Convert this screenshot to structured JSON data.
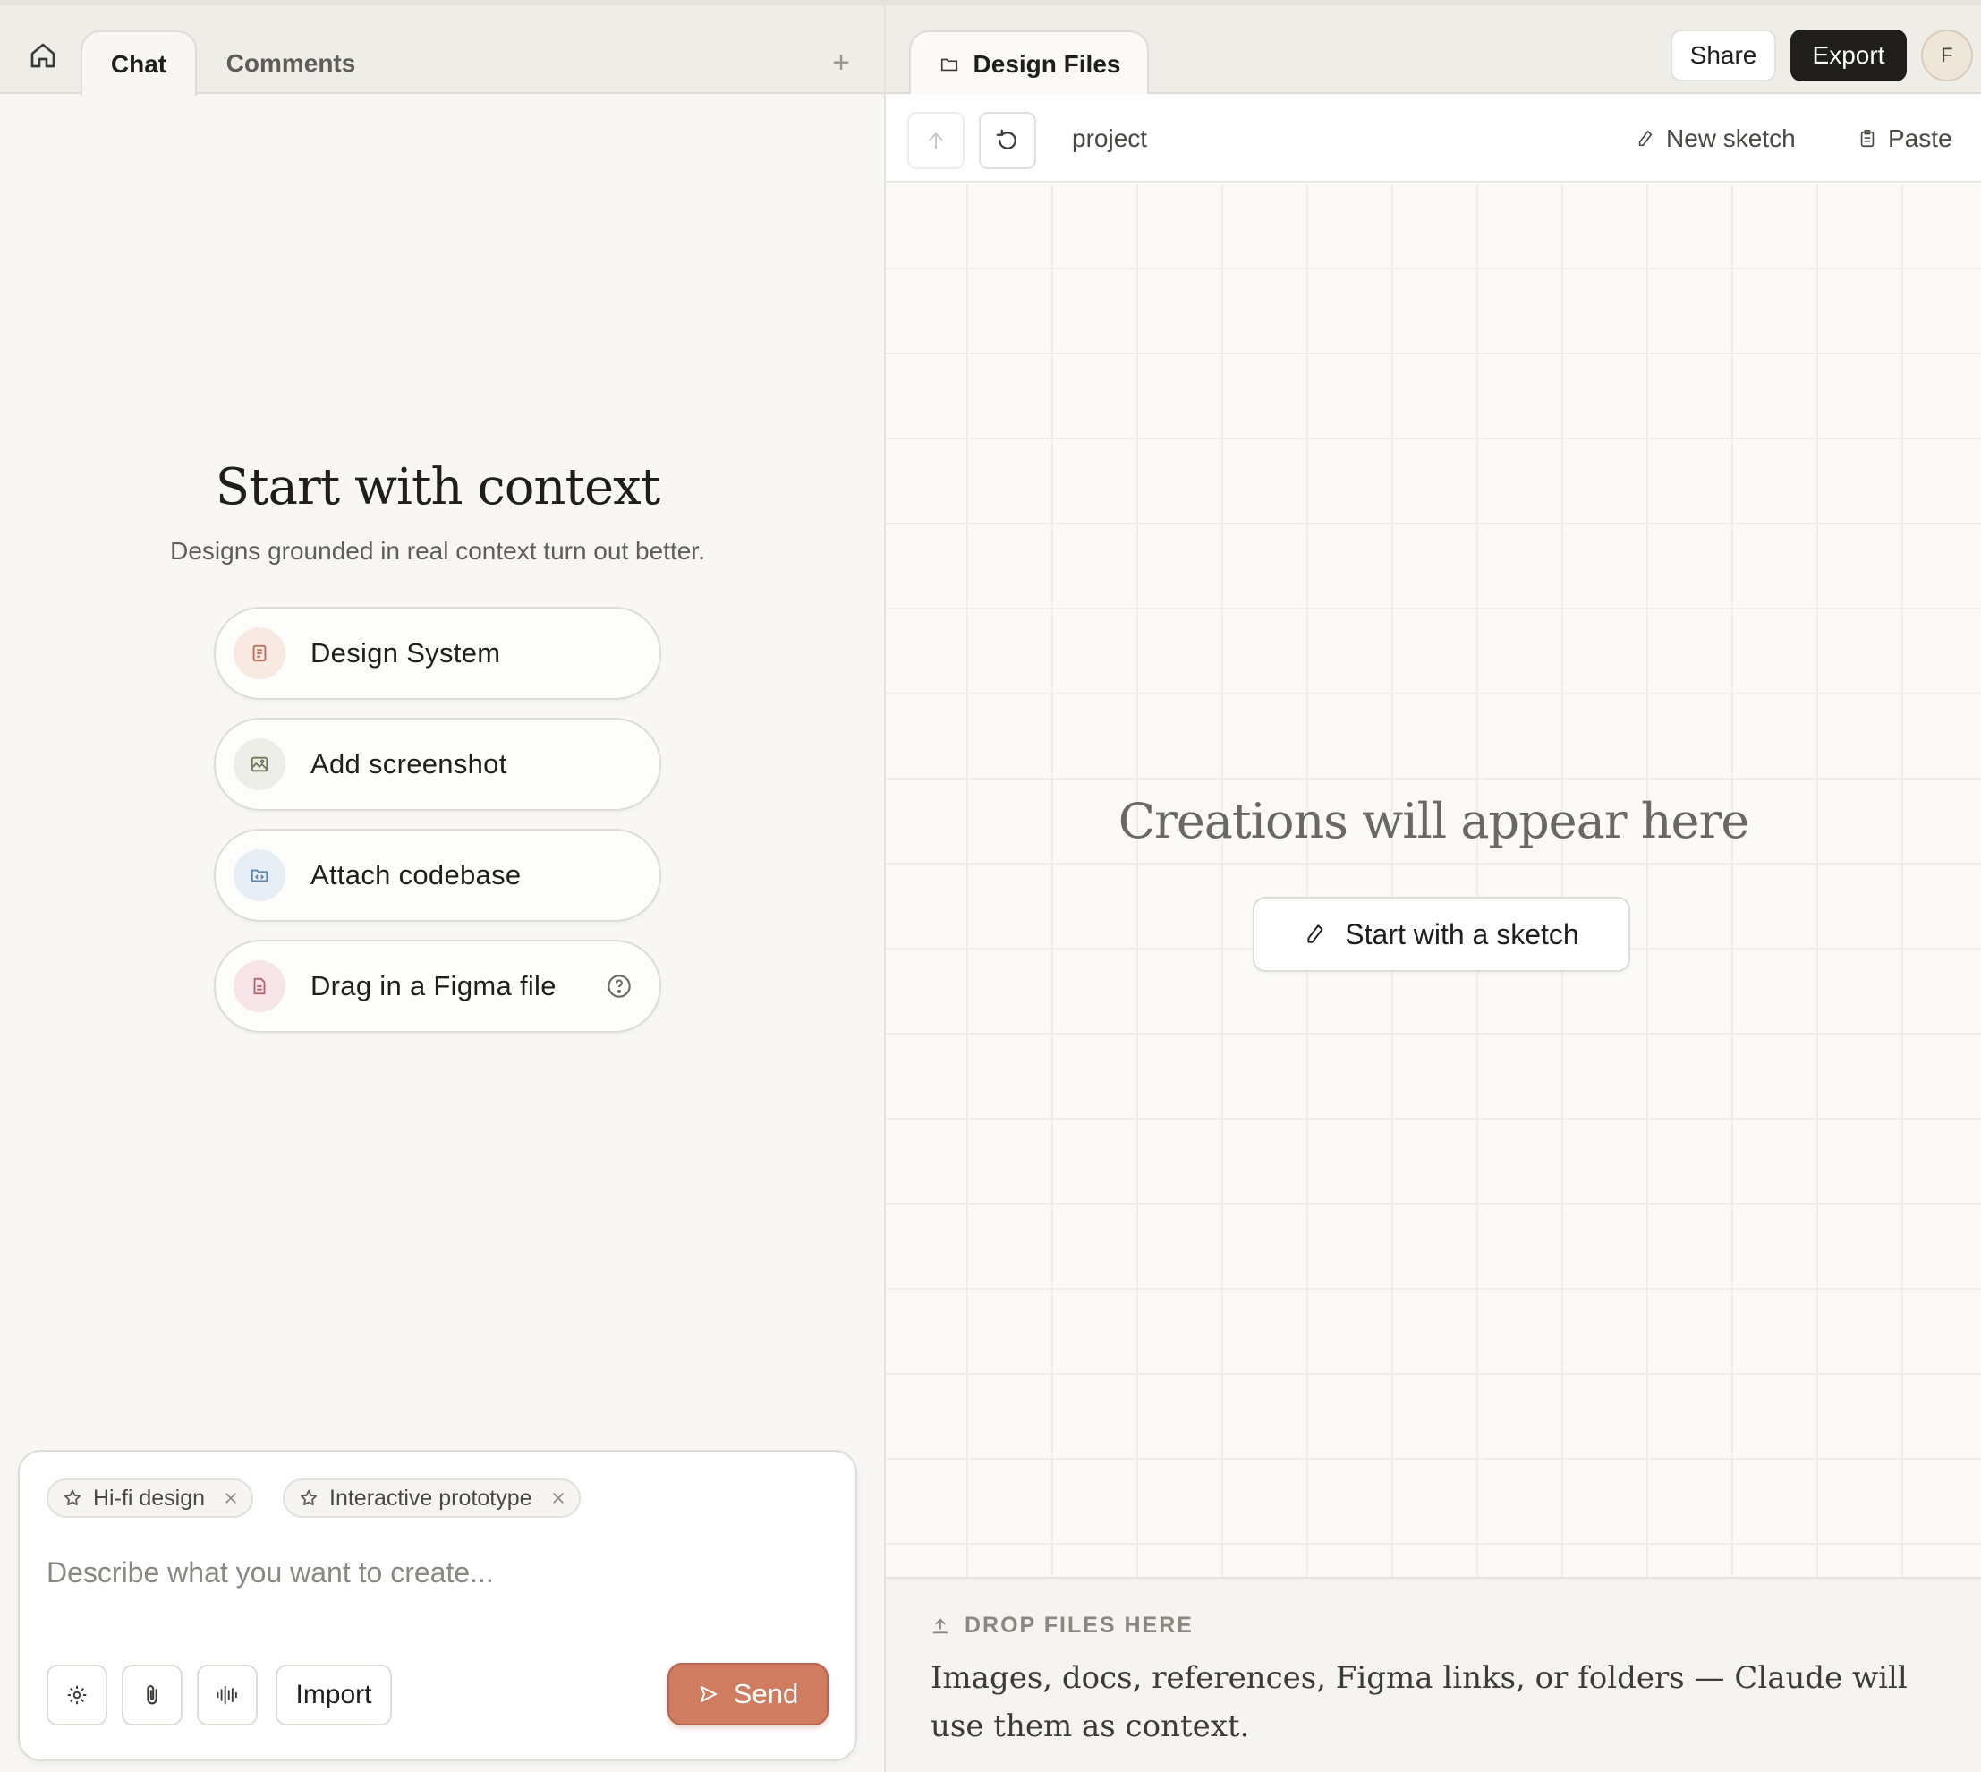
{
  "left_panel": {
    "tabs": [
      {
        "label": "Chat",
        "active": true
      },
      {
        "label": "Comments",
        "active": false
      }
    ],
    "add_tab_symbol": "+",
    "hero": {
      "title": "Start with context",
      "subtitle": "Designs grounded in real context turn out better."
    },
    "context_buttons": [
      {
        "label": "Design System",
        "icon": "design-system-icon",
        "tint": "#f8e9e3"
      },
      {
        "label": "Add screenshot",
        "icon": "image-icon",
        "tint": "#eceee7"
      },
      {
        "label": "Attach codebase",
        "icon": "code-folder-icon",
        "tint": "#e7eef5"
      },
      {
        "label": "Drag in a Figma file",
        "icon": "file-icon",
        "tint": "#f7e5e8",
        "help_icon": "question-circle-icon"
      }
    ],
    "composer": {
      "chips": [
        {
          "label": "Hi-fi design"
        },
        {
          "label": "Interactive prototype"
        }
      ],
      "placeholder": "Describe what you want to create...",
      "value": "",
      "tools": [
        "settings-icon",
        "paperclip-icon",
        "voice-waveform-icon"
      ],
      "import_label": "Import",
      "send_label": "Send"
    }
  },
  "right_panel": {
    "tab_label": "Design Files",
    "share_label": "Share",
    "export_label": "Export",
    "avatar_initial": "F",
    "toolbar": {
      "path": "project",
      "new_sketch_label": "New sketch",
      "paste_label": "Paste"
    },
    "canvas": {
      "empty_title": "Creations will appear here",
      "sketch_button_label": "Start with a sketch"
    },
    "dropzone": {
      "heading": "DROP FILES HERE",
      "text": "Images, docs, references, Figma links, or folders — Claude will use them as context."
    }
  },
  "colors": {
    "accent": "#d07c61",
    "dark_button": "#1f1e1b",
    "panel_bg": "#f8f7f4",
    "tabbar_bg": "#eeede8"
  }
}
